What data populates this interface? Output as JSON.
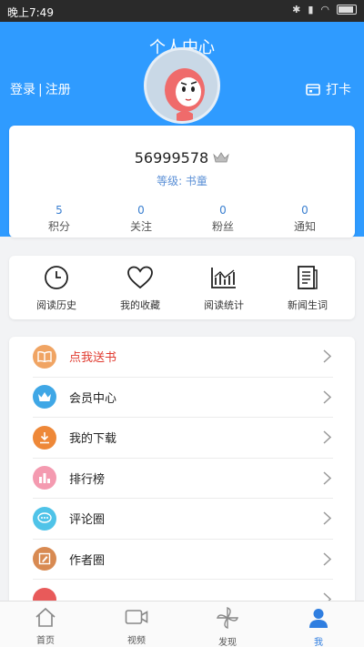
{
  "status_bar": {
    "time": "晚上7:49"
  },
  "header": {
    "title": "个人中心",
    "login": "登录",
    "register": "注册",
    "checkin": "打卡"
  },
  "profile": {
    "user_id": "56999578",
    "level": "等级: 书童"
  },
  "stats": [
    {
      "value": "5",
      "label": "积分"
    },
    {
      "value": "0",
      "label": "关注"
    },
    {
      "value": "0",
      "label": "粉丝"
    },
    {
      "value": "0",
      "label": "通知"
    }
  ],
  "quick_actions": [
    {
      "label": "阅读历史",
      "icon": "clock-icon"
    },
    {
      "label": "我的收藏",
      "icon": "heart-icon"
    },
    {
      "label": "阅读统计",
      "icon": "chart-icon"
    },
    {
      "label": "新闻生词",
      "icon": "notebook-icon"
    }
  ],
  "menu": [
    {
      "label": "点我送书",
      "icon": "book-icon",
      "color": "#f0a463"
    },
    {
      "label": "会员中心",
      "icon": "crown-icon",
      "color": "#3fa7e6"
    },
    {
      "label": "我的下载",
      "icon": "download-icon",
      "color": "#ee8838"
    },
    {
      "label": "排行榜",
      "icon": "ranking-icon",
      "color": "#f49ab0"
    },
    {
      "label": "评论圈",
      "icon": "comment-icon",
      "color": "#4fc3e8"
    },
    {
      "label": "作者圈",
      "icon": "author-icon",
      "color": "#d88a52"
    },
    {
      "label": "",
      "icon": "more-icon",
      "color": "#e85a5a"
    }
  ],
  "tabs": [
    {
      "label": "首页",
      "icon": "home-icon"
    },
    {
      "label": "视频",
      "icon": "video-icon"
    },
    {
      "label": "发现",
      "icon": "discover-icon"
    },
    {
      "label": "我",
      "icon": "person-icon",
      "active": true
    }
  ],
  "colors": {
    "accent": "#2f9bff",
    "highlight": "#e03a2f"
  }
}
